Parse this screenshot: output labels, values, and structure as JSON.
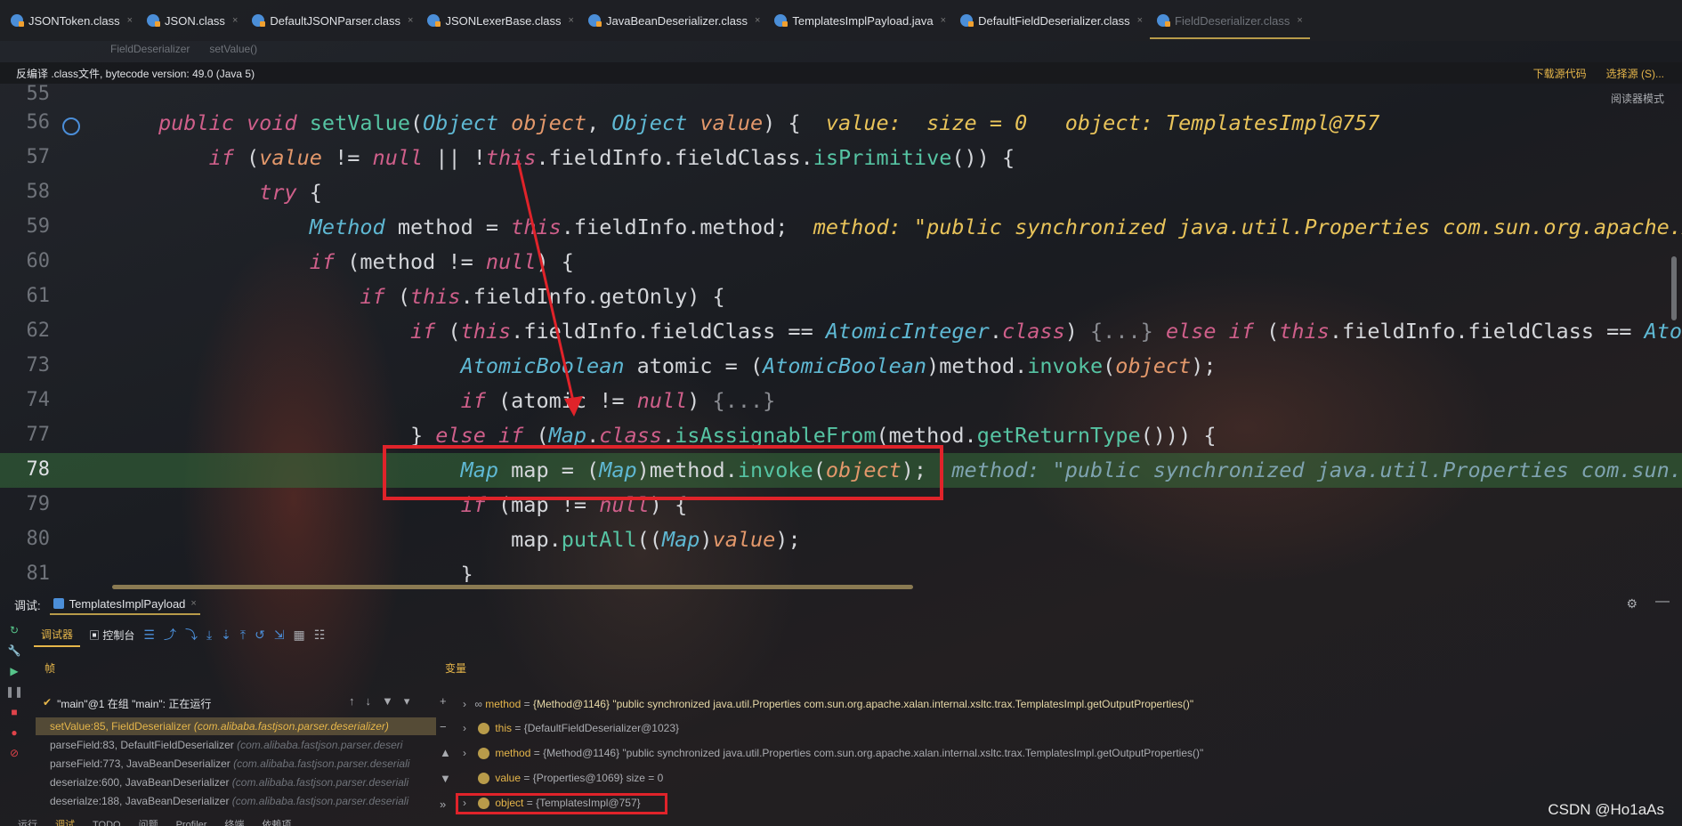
{
  "tabs": [
    {
      "label": "JSONToken.class"
    },
    {
      "label": "JSON.class"
    },
    {
      "label": "DefaultJSONParser.class"
    },
    {
      "label": "JSONLexerBase.class"
    },
    {
      "label": "JavaBeanDeserializer.class"
    },
    {
      "label": "TemplatesImplPayload.java"
    },
    {
      "label": "DefaultFieldDeserializer.class"
    },
    {
      "label": "FieldDeserializer.class"
    }
  ],
  "close_glyph": "×",
  "breadcrumb": {
    "class": "FieldDeserializer",
    "method": "setValue()"
  },
  "infobar": {
    "text": "反编译 .class文件, bytecode version: 49.0 (Java 5)",
    "download": "下载源代码",
    "choose_source": "选择源 (S)..."
  },
  "reader_mode": "阅读器模式",
  "code": {
    "line_numbers": [
      "55",
      "56",
      "57",
      "58",
      "59",
      "60",
      "61",
      "62",
      "73",
      "74",
      "77",
      "78",
      "79",
      "80",
      "81"
    ],
    "hint_56_value": "value:  size = 0",
    "hint_56_object": "object: TemplatesImpl@757",
    "hint_59": "method: \"public synchronized java.util.Properties com.sun.org.apache.x",
    "hint_78": "method: \"public synchronized java.util.Properties com.sun.o"
  },
  "debug": {
    "label": "调试:",
    "session": "TemplatesImplPayload",
    "tab_debugger": "调试器",
    "tab_console": "控制台",
    "frames_header": "帧",
    "variables_header": "变量",
    "thread": "\"main\"@1 在组 \"main\": 正在运行",
    "frames": [
      {
        "method": "setValue:85, FieldDeserializer",
        "pkg": "(com.alibaba.fastjson.parser.deserializer)"
      },
      {
        "method": "parseField:83, DefaultFieldDeserializer",
        "pkg": "(com.alibaba.fastjson.parser.deseri"
      },
      {
        "method": "parseField:773, JavaBeanDeserializer",
        "pkg": "(com.alibaba.fastjson.parser.deseriali"
      },
      {
        "method": "deserialze:600, JavaBeanDeserializer",
        "pkg": "(com.alibaba.fastjson.parser.deseriali"
      },
      {
        "method": "deserialze:188, JavaBeanDeserializer",
        "pkg": "(com.alibaba.fastjson.parser.deseriali"
      }
    ],
    "variables": [
      {
        "name": "method",
        "value": "{Method@1146} \"public synchronized java.util.Properties com.sun.org.apache.xalan.internal.xsltc.trax.TemplatesImpl.getOutputProperties()\""
      },
      {
        "name": "this",
        "value": "{DefaultFieldDeserializer@1023}"
      },
      {
        "name": "method",
        "value": "{Method@1146} \"public synchronized java.util.Properties com.sun.org.apache.xalan.internal.xsltc.trax.TemplatesImpl.getOutputProperties()\""
      },
      {
        "name": "value",
        "value": "{Properties@1069}  size = 0"
      },
      {
        "name": "object",
        "value": "{TemplatesImpl@757}"
      }
    ]
  },
  "bottom": [
    "运行",
    "调试",
    "TODO",
    "问题",
    "Profiler",
    "终端",
    "依赖项"
  ],
  "watermark": "CSDN @Ho1aAs"
}
